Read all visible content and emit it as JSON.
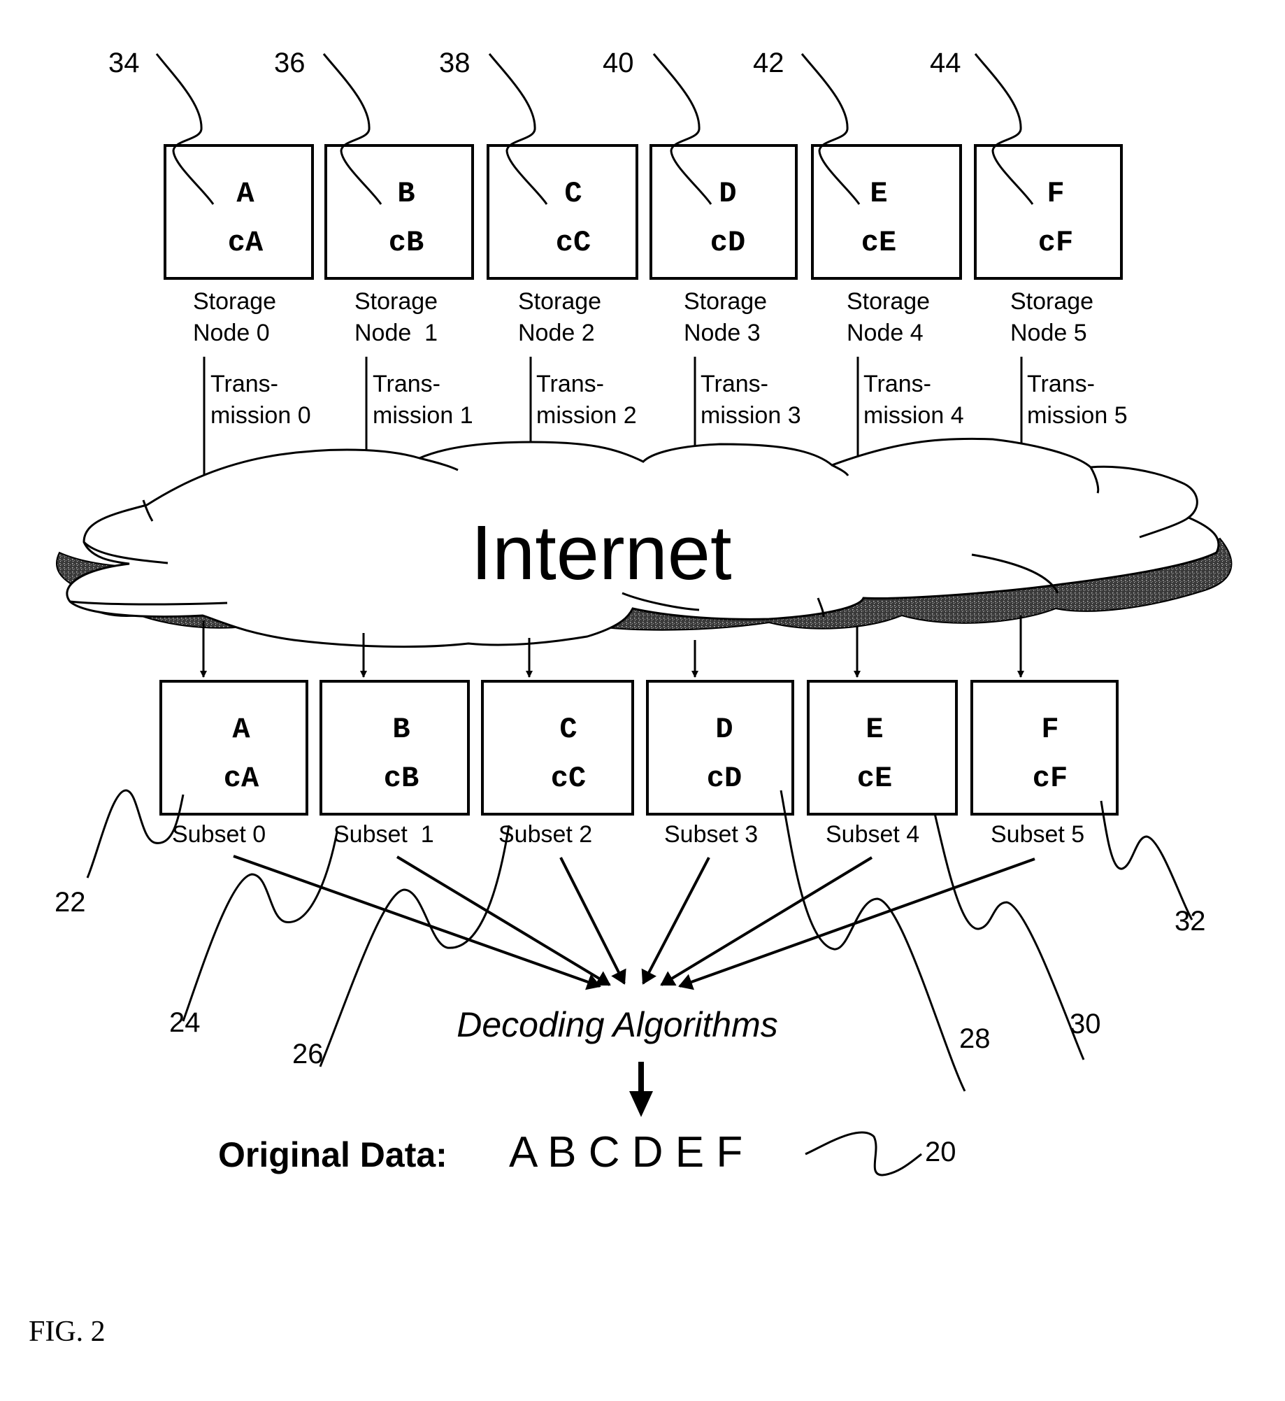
{
  "figure": {
    "label": "FIG. 2",
    "cloud_label": "Internet",
    "decoder_label": "Decoding Algorithms",
    "output_label": "Original Data:",
    "output_value": "A B C D E F",
    "output_ref": "20"
  },
  "storage_nodes": [
    {
      "ref": "34",
      "data": "A",
      "code": "cA",
      "name_line1": "Storage",
      "name_line2": "Node 0",
      "transmission_line1": "Trans-",
      "transmission_line2": "mission 0"
    },
    {
      "ref": "36",
      "data": "B",
      "code": "cB",
      "name_line1": "Storage",
      "name_line2": "Node  1",
      "transmission_line1": "Trans-",
      "transmission_line2": "mission 1"
    },
    {
      "ref": "38",
      "data": "C",
      "code": "cC",
      "name_line1": "Storage",
      "name_line2": "Node 2",
      "transmission_line1": "Trans-",
      "transmission_line2": "mission 2"
    },
    {
      "ref": "40",
      "data": "D",
      "code": "cD",
      "name_line1": "Storage",
      "name_line2": "Node 3",
      "transmission_line1": "Trans-",
      "transmission_line2": "mission 3"
    },
    {
      "ref": "42",
      "data": "E",
      "code": "cE",
      "name_line1": "Storage",
      "name_line2": "Node 4",
      "transmission_line1": "Trans-",
      "transmission_line2": "mission 4"
    },
    {
      "ref": "44",
      "data": "F",
      "code": "cF",
      "name_line1": "Storage",
      "name_line2": "Node 5",
      "transmission_line1": "Trans-",
      "transmission_line2": "mission 5"
    }
  ],
  "subsets": [
    {
      "ref": "22",
      "data": "A",
      "code": "cA",
      "label": "Subset 0"
    },
    {
      "ref": "24",
      "data": "B",
      "code": "cB",
      "label": "Subset  1"
    },
    {
      "ref": "26",
      "data": "C",
      "code": "cC",
      "label": "Subset 2"
    },
    {
      "ref": "28",
      "data": "D",
      "code": "cD",
      "label": "Subset 3"
    },
    {
      "ref": "30",
      "data": "E",
      "code": "cE",
      "label": "Subset 4"
    },
    {
      "ref": "32",
      "data": "F",
      "code": "cF",
      "label": "Subset 5"
    }
  ]
}
